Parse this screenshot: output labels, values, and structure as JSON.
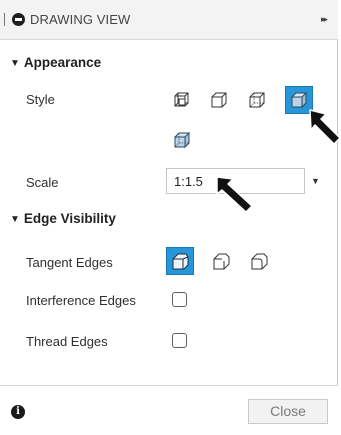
{
  "title_bar": {
    "title": "DRAWING VIEW",
    "expand_label": "▸▸"
  },
  "appearance": {
    "heading": "Appearance",
    "style_label": "Style",
    "style_options": [
      "visible-edges-icon",
      "visible-and-hidden-edges-icon",
      "shaded-icon",
      "shaded-selected-icon",
      "shaded-with-hidden-edges-icon"
    ],
    "selected_style": "shaded-selected-icon",
    "scale_label": "Scale",
    "scale_value": "1:1.5"
  },
  "edge_visibility": {
    "heading": "Edge Visibility",
    "tangent_label": "Tangent Edges",
    "tangent_options": [
      "full-length-tangent-icon",
      "shortened-tangent-icon",
      "no-tangent-icon"
    ],
    "selected_tangent": "full-length-tangent-icon",
    "interference_label": "Interference Edges",
    "interference_checked": false,
    "thread_label": "Thread Edges",
    "thread_checked": false
  },
  "footer": {
    "close_label": "Close"
  },
  "colors": {
    "accent": "#2796d8",
    "accent_border": "#1877b5",
    "titlebar_bg": "#f3f3f3"
  }
}
